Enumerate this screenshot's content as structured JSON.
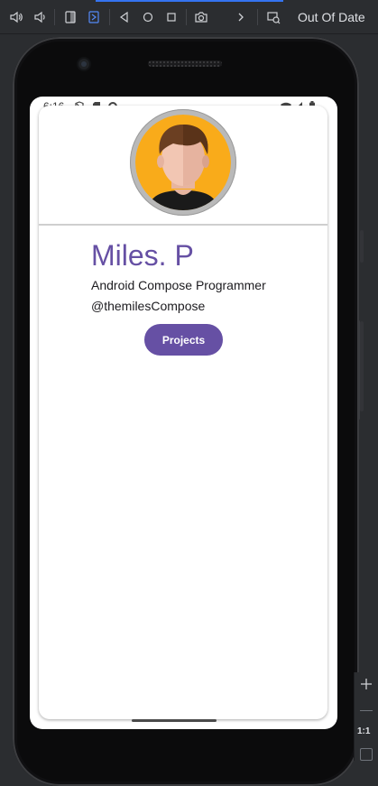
{
  "toolbar": {
    "status_label": "Out Of Date",
    "icons": [
      "volume-up-icon",
      "volume-down-icon",
      "rotate-left-icon",
      "rotate-right-icon",
      "back-icon",
      "home-icon",
      "overview-icon",
      "camera-icon",
      "chevron-right-icon",
      "screen-record-icon"
    ]
  },
  "side_panel": {
    "ratio_label": "1:1"
  },
  "device": {
    "status_bar": {
      "time": "6:16"
    }
  },
  "profile": {
    "name": "Miles. P",
    "role": "Android Compose Programmer",
    "handle": "@themilesCompose",
    "projects_button": "Projects"
  },
  "colors": {
    "accent": "#6650a4",
    "ide_accent": "#3574f0",
    "avatar_background": "#f9ab1a"
  }
}
